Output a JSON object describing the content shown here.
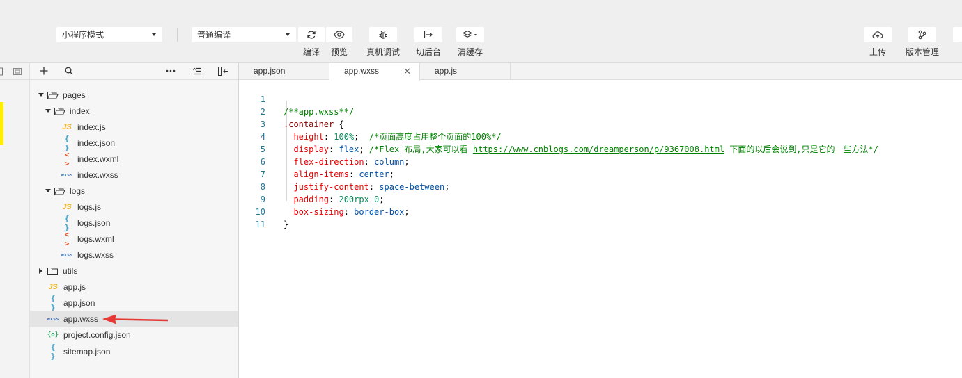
{
  "toolbar": {
    "mode_select": "小程序模式",
    "compile_select": "普通编译",
    "buttons": {
      "compile": "编译",
      "preview": "预览",
      "real_debug": "真机调试",
      "background": "切后台",
      "clear_cache": "清缓存",
      "upload": "上传",
      "version": "版本管理"
    }
  },
  "tree": {
    "pages": "pages",
    "index": "index",
    "index_js": "index.js",
    "index_json": "index.json",
    "index_wxml": "index.wxml",
    "index_wxss": "index.wxss",
    "logs": "logs",
    "logs_js": "logs.js",
    "logs_json": "logs.json",
    "logs_wxml": "logs.wxml",
    "logs_wxss": "logs.wxss",
    "utils": "utils",
    "app_js": "app.js",
    "app_json": "app.json",
    "app_wxss": "app.wxss",
    "project_config": "project.config.json",
    "sitemap": "sitemap.json"
  },
  "icons": {
    "js": "JS",
    "json": "{ }",
    "wxml": "< >",
    "wxss": "wxss",
    "config": "{o}"
  },
  "tabs": {
    "t1": "app.json",
    "t2": "app.wxss",
    "t3": "app.js"
  },
  "code": {
    "line_numbers": [
      "1",
      "2",
      "3",
      "4",
      "5",
      "6",
      "7",
      "8",
      "9",
      "10",
      "11"
    ],
    "l1": "/**app.wxss**/",
    "l2_sel": ".container",
    "l2_brace": " {",
    "l3_prop": "height",
    "l3_val": "100%",
    "l3_com": "/*页面高度占用整个页面的100%*/",
    "l4_prop": "display",
    "l4_val": "flex",
    "l4_com_a": "/*Flex 布局,大家可以看 ",
    "l4_link": "https://www.cnblogs.com/dreamperson/p/9367008.html",
    "l4_com_b": " 下面的以后会说到,只是它的一些方法*/",
    "l5_prop": "flex-direction",
    "l5_val": "column",
    "l6_prop": "align-items",
    "l6_val": "center",
    "l7_prop": "justify-content",
    "l7_val": "space-between",
    "l8_prop": "padding",
    "l8_val": "200rpx 0",
    "l9_prop": "box-sizing",
    "l9_val": "border-box",
    "l10": "}"
  },
  "colors": {
    "comment": "#008000",
    "selector": "#800000",
    "property": "#e50000",
    "value": "#0451a5",
    "number": "#098658",
    "line_number": "#237893",
    "annotation_arrow": "#e53935",
    "highlight_mark": "#ffee00"
  }
}
